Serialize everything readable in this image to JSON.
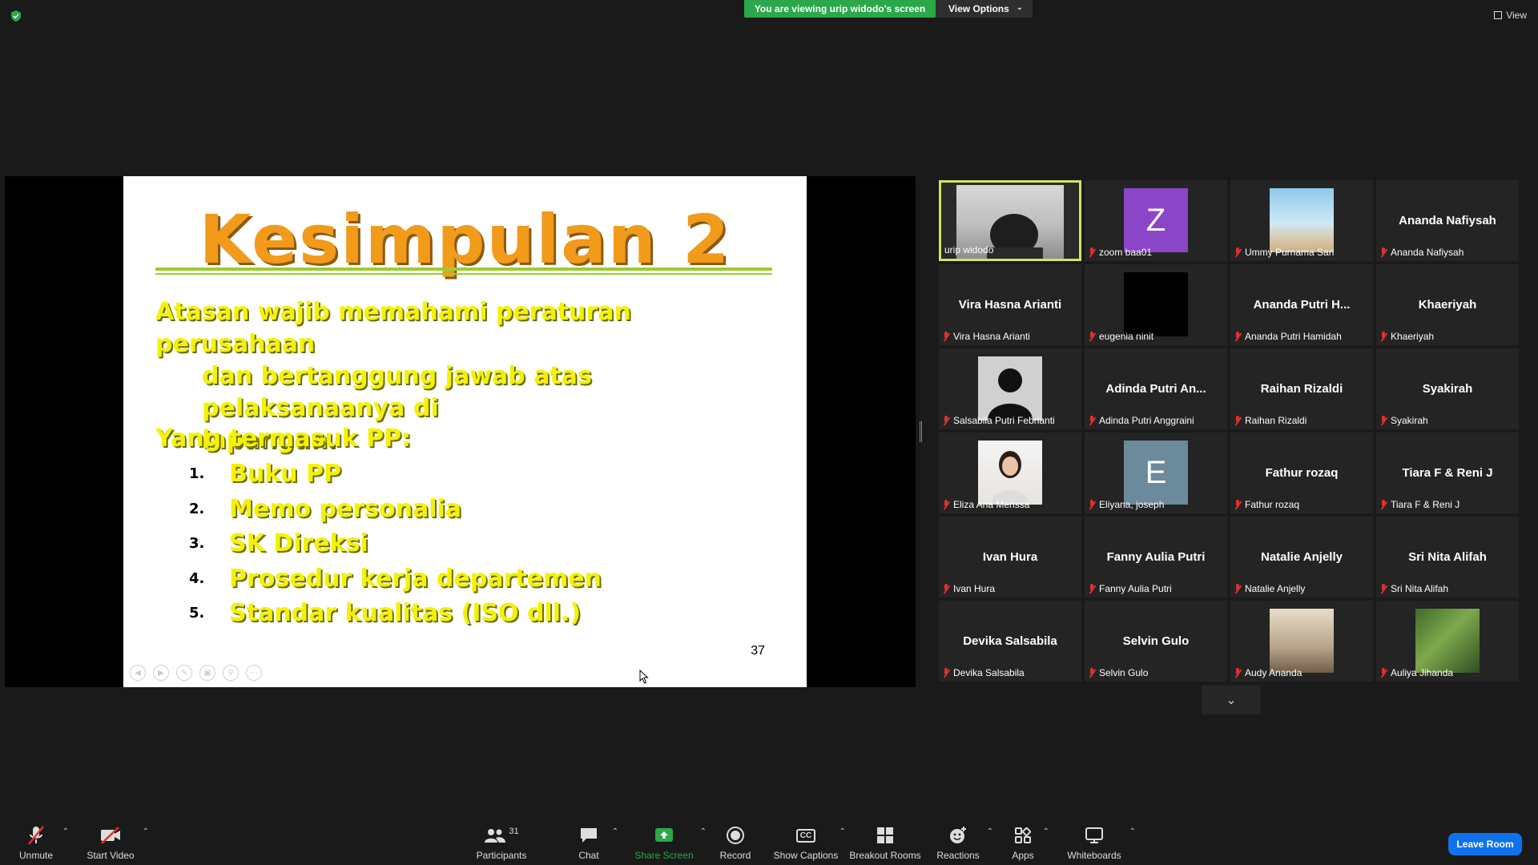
{
  "top": {
    "viewing_banner": "You are viewing urip widodo's screen",
    "view_options": "View Options",
    "view": "View"
  },
  "slide": {
    "title": "Kesimpulan  2",
    "para_line1": "Atasan wajib memahami peraturan perusahaan",
    "para_line2": "dan bertanggung jawab atas pelaksanaanya di",
    "para_line3": "lapangan.",
    "subheading": "Yang termasuk PP:",
    "items": [
      {
        "num": "1.",
        "text": "Buku PP"
      },
      {
        "num": "2.",
        "text": "Memo personalia"
      },
      {
        "num": "3.",
        "text": "SK Direksi"
      },
      {
        "num": "4.",
        "text": "Prosedur kerja departemen"
      },
      {
        "num": "5.",
        "text": "Standar kualitas (ISO dll.)"
      }
    ],
    "page_number": "37"
  },
  "participants": [
    {
      "label": "urip widodo",
      "center": "",
      "kind": "video"
    },
    {
      "label": "zoom baa01",
      "center": "Z",
      "kind": "letter",
      "color": "#8b45c9"
    },
    {
      "label": "Ummy Purnama Sari",
      "center": "",
      "kind": "photo"
    },
    {
      "label": "Ananda Nafiysah",
      "center": "Ananda Nafiysah",
      "kind": "name"
    },
    {
      "label": "Vira Hasna Arianti",
      "center": "Vira Hasna Arianti",
      "kind": "name"
    },
    {
      "label": "eugenia ninit",
      "center": "",
      "kind": "black"
    },
    {
      "label": "Ananda Putri Hamidah",
      "center": "Ananda  Putri  H...",
      "kind": "name"
    },
    {
      "label": "Khaeriyah",
      "center": "Khaeriyah",
      "kind": "name"
    },
    {
      "label": "Salsabila Putri Febrianti",
      "center": "",
      "kind": "silhouette"
    },
    {
      "label": "Adinda Putri Anggraini",
      "center": "Adinda Putri An...",
      "kind": "name"
    },
    {
      "label": "Raihan Rizaldi",
      "center": "Raihan Rizaldi",
      "kind": "name"
    },
    {
      "label": "Syakirah",
      "center": "Syakirah",
      "kind": "name"
    },
    {
      "label": "Eliza Ana Merissa",
      "center": "",
      "kind": "photo2"
    },
    {
      "label": "Eliyana, joseph",
      "center": "E",
      "kind": "letter",
      "color": "#6b8a9b"
    },
    {
      "label": "Fathur rozaq",
      "center": "Fathur rozaq",
      "kind": "name"
    },
    {
      "label": "Tiara F & Reni J",
      "center": "Tiara F & Reni J",
      "kind": "name"
    },
    {
      "label": "Ivan Hura",
      "center": "Ivan Hura",
      "kind": "name"
    },
    {
      "label": "Fanny Aulia Putri",
      "center": "Fanny Aulia Putri",
      "kind": "name"
    },
    {
      "label": "Natalie Anjelly",
      "center": "Natalie Anjelly",
      "kind": "name"
    },
    {
      "label": "Sri Nita Alifah",
      "center": "Sri Nita Alifah",
      "kind": "name"
    },
    {
      "label": "Devika Salsabila",
      "center": "Devika Salsabila",
      "kind": "name"
    },
    {
      "label": "Selvin Gulo",
      "center": "Selvin Gulo",
      "kind": "name"
    },
    {
      "label": "Audy Ananda",
      "center": "",
      "kind": "photo3"
    },
    {
      "label": "Auliya Jihanda",
      "center": "",
      "kind": "photo4"
    }
  ],
  "toolbar": {
    "unmute": "Unmute",
    "start_video": "Start Video",
    "participants": "Participants",
    "participants_count": "31",
    "chat": "Chat",
    "share_screen": "Share Screen",
    "record": "Record",
    "show_captions": "Show Captions",
    "captions_icon": "CC",
    "breakout_rooms": "Breakout Rooms",
    "reactions": "Reactions",
    "apps": "Apps",
    "whiteboards": "Whiteboards",
    "leave_room": "Leave Room"
  },
  "colors": {
    "share_green": "#2aa84a",
    "active_speaker": "#d6e35a",
    "leave_blue": "#0e72ed",
    "slide_title": "#f29a1a",
    "slide_text": "#f5f200"
  }
}
